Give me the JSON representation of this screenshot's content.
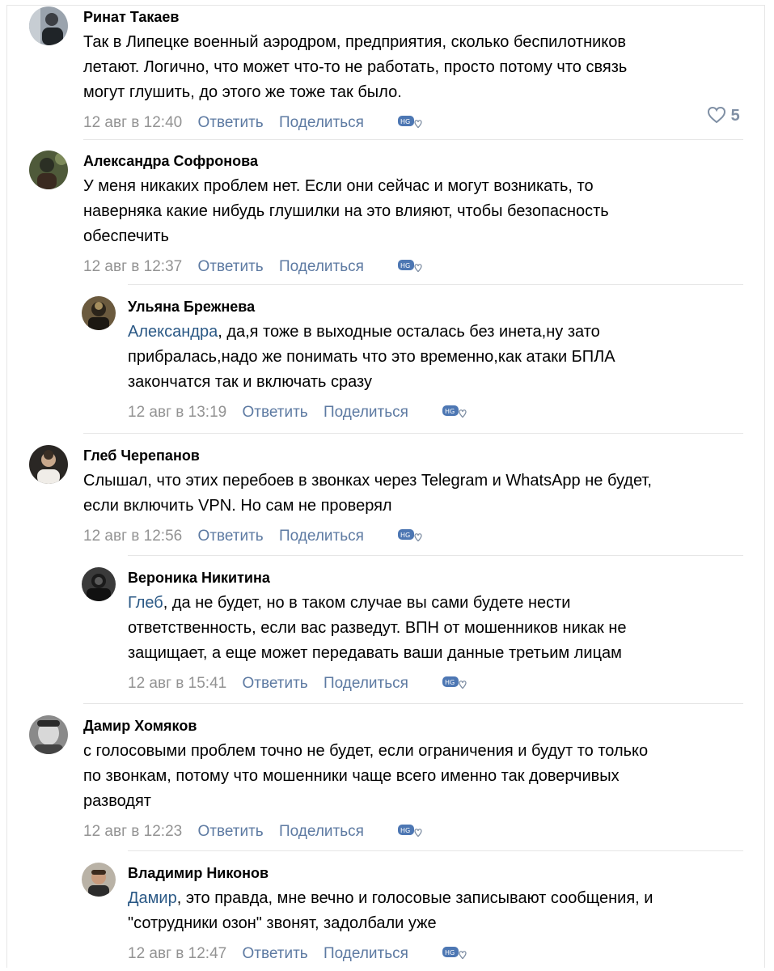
{
  "comments": [
    {
      "author": "Ринат Такаев",
      "lines": [
        "Так в Липецке военный аэродром, предприятия, сколько беспилотников",
        "летают. Логично, что может что-то не работать, просто потому что связь",
        "могут глушить, до этого же тоже так было."
      ],
      "time": "12 авг в 12:40",
      "reply_label": "Ответить",
      "share_label": "Поделиться",
      "likes": "5"
    },
    {
      "author": "Александра Софронова",
      "lines": [
        "У меня никаких проблем нет. Если они сейчас и могут возникать, то",
        "наверняка какие нибудь глушилки на это влияют, чтобы безопасность",
        "обеспечить"
      ],
      "time": "12 авг в 12:37",
      "reply_label": "Ответить",
      "share_label": "Поделиться"
    },
    {
      "author": "Ульяна Брежнева",
      "mention": "Александра",
      "lines": [
        ", да,я тоже в выходные осталась без инета,ну зато",
        "прибралась,надо же понимать что это временно,как атаки БПЛА",
        "закончатся так и включать сразу"
      ],
      "time": "12 авг в 13:19",
      "reply_label": "Ответить",
      "share_label": "Поделиться"
    },
    {
      "author": "Глеб Черепанов",
      "lines": [
        "Слышал, что этих перебоев в звонках через Telegram и WhatsApp не будет,",
        "если включить VPN. Но сам не проверял"
      ],
      "time": "12 авг в 12:56",
      "reply_label": "Ответить",
      "share_label": "Поделиться"
    },
    {
      "author": "Вероника Никитина",
      "mention": "Глеб",
      "lines": [
        ", да не будет, но в таком случае вы сами будете нести",
        "ответственность, если вас разведут. ВПН от мошенников никак не",
        "защищает, а еще может передавать ваши данные третьим лицам"
      ],
      "time": "12 авг в 15:41",
      "reply_label": "Ответить",
      "share_label": "Поделиться"
    },
    {
      "author": "Дамир Хомяков",
      "lines": [
        "с голосовыми проблем точно не будет, если ограничения и будут то только",
        "по звонкам, потому что мошенники чаще всего именно так доверчивых",
        "разводят"
      ],
      "time": "12 авг в 12:23",
      "reply_label": "Ответить",
      "share_label": "Поделиться"
    },
    {
      "author": "Владимир Никонов",
      "mention": "Дамир",
      "lines": [
        ", это правда, мне вечно и голосовые записывают сообщения, и",
        "\"сотрудники озон\" звонят, задолбали уже"
      ],
      "time": "12 авг в 12:47",
      "reply_label": "Ответить",
      "share_label": "Поделиться"
    }
  ],
  "colors": {
    "link": "#5d7aa2",
    "mention": "#2a5885",
    "meta_gray": "#939393",
    "separator": "#e6e6e6"
  },
  "icons": {
    "reaction": "reaction-heart-icon",
    "like": "heart-outline-icon"
  }
}
